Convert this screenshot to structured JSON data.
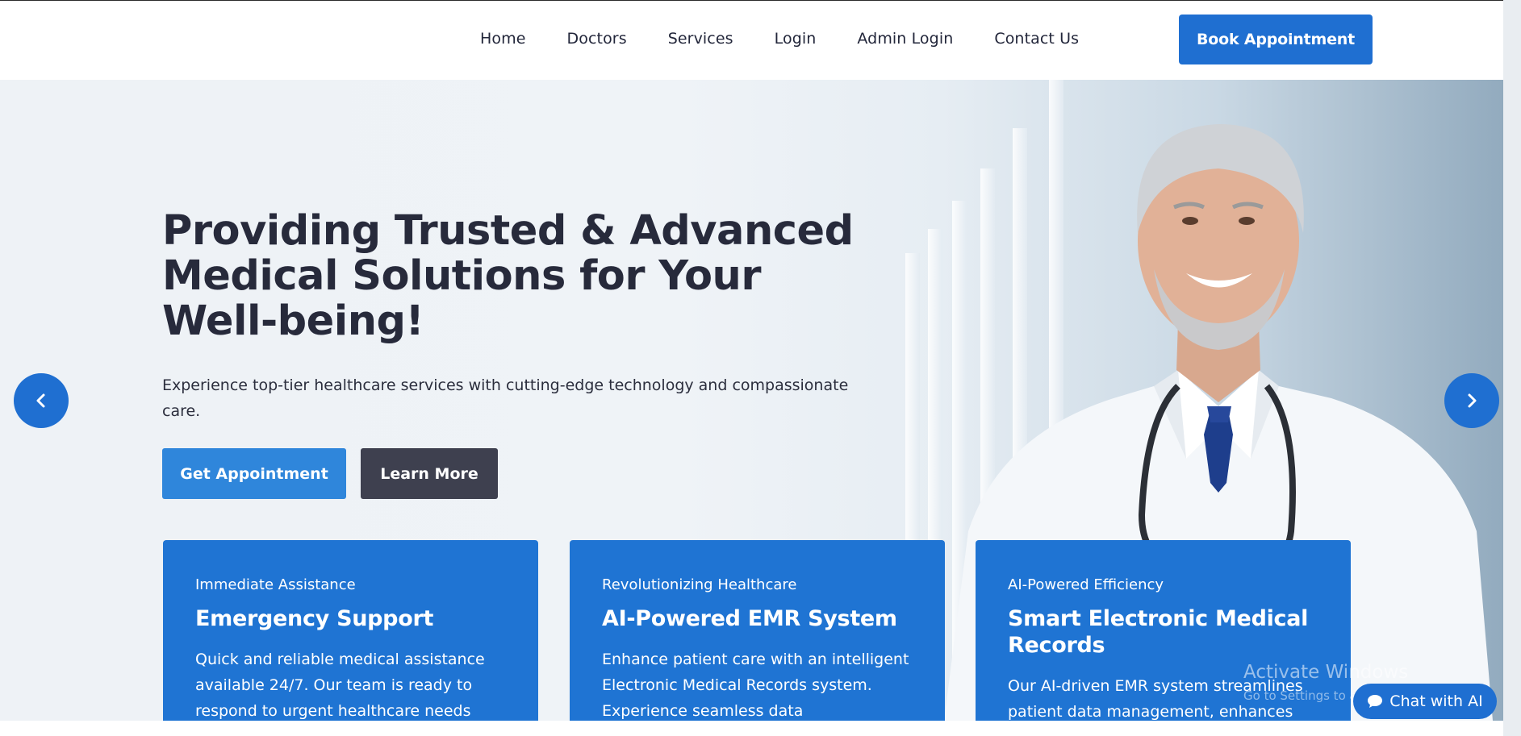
{
  "nav": {
    "items": [
      "Home",
      "Doctors",
      "Services",
      "Login",
      "Admin Login",
      "Contact Us"
    ],
    "book_label": "Book Appointment"
  },
  "hero": {
    "headline": "Providing Trusted & Advanced Medical Solutions for Your Well-being!",
    "subtext": "Experience top-tier healthcare services with cutting-edge technology and compassionate care.",
    "primary_cta": "Get Appointment",
    "secondary_cta": "Learn More"
  },
  "cards": [
    {
      "kicker": "Immediate Assistance",
      "title": "Emergency Support",
      "body": "Quick and reliable medical assistance available 24/7. Our team is ready to respond to urgent healthcare needs with"
    },
    {
      "kicker": "Revolutionizing Healthcare",
      "title": "AI-Powered EMR System",
      "body": "Enhance patient care with an intelligent Electronic Medical Records system. Experience seamless data management,"
    },
    {
      "kicker": "AI-Powered Efficiency",
      "title": "Smart Electronic Medical Records",
      "body": "Our AI-driven EMR system streamlines patient data management, enhances"
    }
  ],
  "os_watermark": {
    "title": "Activate Windows",
    "subtitle": "Go to Settings to activate Windows."
  },
  "chat": {
    "label": "Chat with AI",
    "icon": "chat-bubble-icon"
  },
  "colors": {
    "brand": "#1f6fd1",
    "card": "#1f74d3",
    "dark_button": "#3e404f",
    "text": "#272a3b"
  }
}
